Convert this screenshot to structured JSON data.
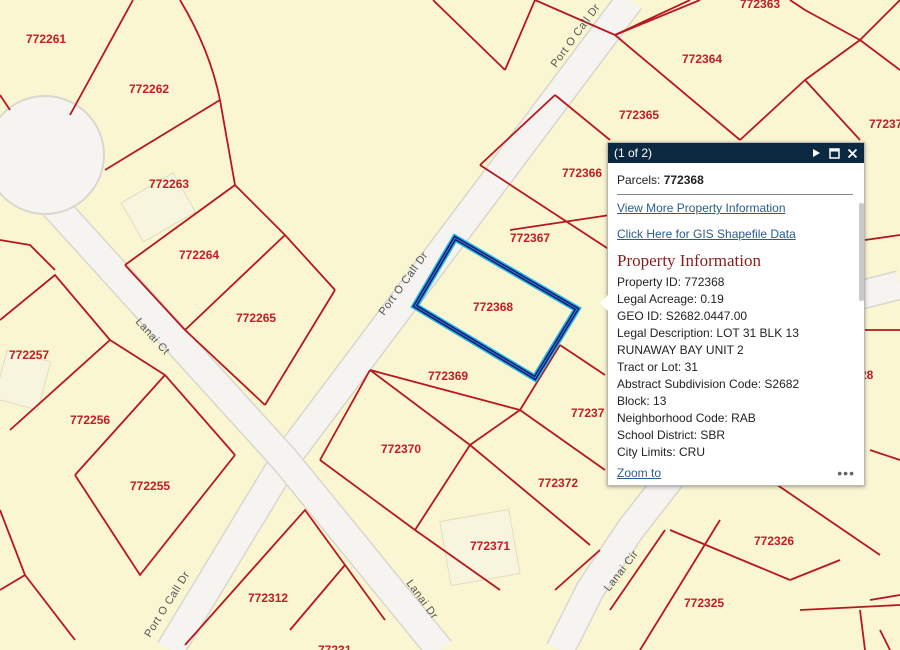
{
  "map": {
    "parcels": [
      {
        "id": "772261"
      },
      {
        "id": "772262"
      },
      {
        "id": "772263"
      },
      {
        "id": "772264"
      },
      {
        "id": "772265"
      },
      {
        "id": "772257"
      },
      {
        "id": "772256"
      },
      {
        "id": "772255"
      },
      {
        "id": "772363"
      },
      {
        "id": "772364"
      },
      {
        "id": "772365"
      },
      {
        "id": "772366"
      },
      {
        "id": "772367"
      },
      {
        "id": "772368"
      },
      {
        "id": "772369"
      },
      {
        "id": "772370"
      },
      {
        "id": "772371"
      },
      {
        "id": "772372"
      },
      {
        "id": "772312"
      },
      {
        "id": "772326"
      },
      {
        "id": "772325"
      },
      {
        "id": "77237"
      },
      {
        "id": "77237"
      },
      {
        "id": "28"
      },
      {
        "id": "77231"
      }
    ],
    "roads": [
      "Port O Call Dr",
      "Port O Call Dr",
      "Port O Call Dr",
      "Lanai Ct",
      "Lanai Dr",
      "Lanai Cir"
    ],
    "selected_parcel": "772368",
    "colors": {
      "parcel_line": "#b8171e",
      "label": "#c41c24",
      "background": "#fbf6d2",
      "selection": "#0a1f6b",
      "selection_glow": "#29b6e6"
    }
  },
  "popup": {
    "counter": "(1 of 2)",
    "title_label": "Parcels:",
    "title_value": "772368",
    "link_more": "View More Property Information",
    "link_gis": "Click Here for GIS Shapefile Data",
    "section_title": "Property Information",
    "fields": [
      {
        "label": "Property ID:",
        "value": "772368"
      },
      {
        "label": "Legal Acreage:",
        "value": "0.19"
      },
      {
        "label": "GEO ID:",
        "value": "S2682.0447.00"
      },
      {
        "label": "Legal Description:",
        "value": "LOT 31 BLK 13 RUNAWAY BAY UNIT 2"
      },
      {
        "label": "Tract or Lot:",
        "value": "31"
      },
      {
        "label": "Abstract Subdivision Code:",
        "value": "S2682"
      },
      {
        "label": "Block:",
        "value": "13"
      },
      {
        "label": "Neighborhood Code:",
        "value": "RAB"
      },
      {
        "label": "School District:",
        "value": "SBR"
      },
      {
        "label": "City Limits:",
        "value": "CRU"
      }
    ],
    "zoom_label": "Zoom to",
    "more_label": "•••",
    "icons": [
      "next-icon",
      "maximize-icon",
      "close-icon"
    ]
  }
}
